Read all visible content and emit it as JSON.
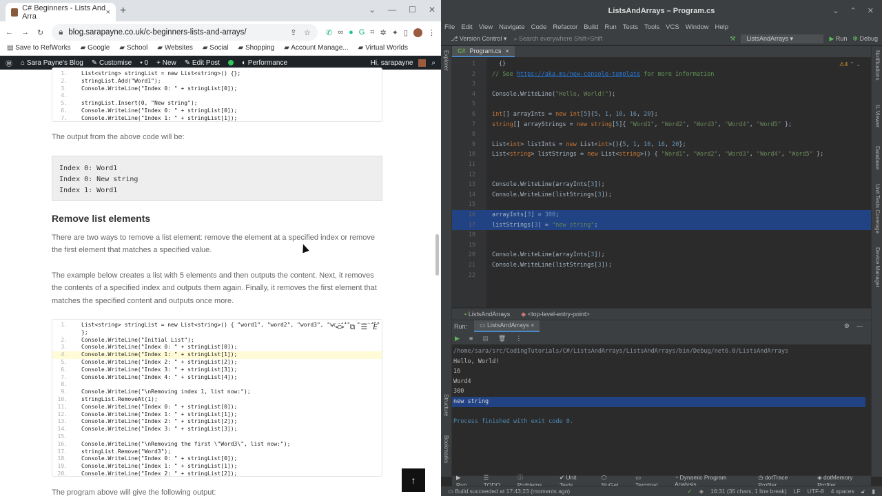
{
  "browser": {
    "tab_title": "C# Beginners - Lists And Arra",
    "tab_close": "×",
    "new_tab": "+",
    "url": "blog.sarapayne.co.uk/c-beginners-lists-and-arrays/",
    "bookmarks": [
      "Save to RefWorks",
      "Google",
      "School",
      "Websites",
      "Social",
      "Shopping",
      "Account Manage...",
      "Virtual Worlds"
    ],
    "wp_bar": {
      "site": "Sara Payne's Blog",
      "customise": "Customise",
      "comments": "0",
      "new": "New",
      "edit": "Edit Post",
      "performance": "Performance",
      "greeting": "Hi, sarapayne"
    }
  },
  "article": {
    "code1": [
      {
        "n": "1.",
        "t": "List<string> stringList = new List<string>() {};"
      },
      {
        "n": "2.",
        "t": "stringList.Add(\"Word1\");"
      },
      {
        "n": "3.",
        "t": "Console.WriteLine(\"Index 0: \" + stringList[0]);"
      },
      {
        "n": "4.",
        "t": ""
      },
      {
        "n": "5.",
        "t": "stringList.Insert(0, \"New string\");"
      },
      {
        "n": "6.",
        "t": "Console.WriteLine(\"Index 0: \" + stringList[0]);"
      },
      {
        "n": "7.",
        "t": "Console.WriteLine(\"Index 1: \" + stringList[1]);"
      }
    ],
    "output_intro": "The output from the above code will be:",
    "output1": [
      "Index 0: Word1",
      "Index 0: New string",
      "Index 1: Word1"
    ],
    "heading": "Remove list elements",
    "para1": "There are two ways to remove a list element: remove the element at a specified index or remove the first element that matches a specified value.",
    "para2": "The example below creates a list with 5 elements and then outputs the content. Next, it removes the contents of a specified index and outputs them again. Finally, it removes the first element that matches the specified content and outputs once more.",
    "code2": [
      {
        "n": "1.",
        "t": "List<string> stringList = new List<string>() { \"word1\", \"word2\", \"word3\", \"word4\", \"word5\""
      },
      {
        "n": "",
        "t": "};"
      },
      {
        "n": "2.",
        "t": "Console.WriteLine(\"Initial List\");"
      },
      {
        "n": "3.",
        "t": "Console.WriteLine(\"Index 0: \" + stringList[0]);"
      },
      {
        "n": "4.",
        "t": "Console.WriteLine(\"Index 1: \" + stringList[1]);"
      },
      {
        "n": "5.",
        "t": "Console.WriteLine(\"Index 2: \" + stringList[2]);"
      },
      {
        "n": "6.",
        "t": "Console.WriteLine(\"Index 3: \" + stringList[3]);"
      },
      {
        "n": "7.",
        "t": "Console.WriteLine(\"Index 4: \" + stringList[4]);"
      },
      {
        "n": "8.",
        "t": ""
      },
      {
        "n": "9.",
        "t": "Console.WriteLine(\"\\nRemoving index 1, list now:\");"
      },
      {
        "n": "10.",
        "t": "stringList.RemoveAt(1);"
      },
      {
        "n": "11.",
        "t": "Console.WriteLine(\"Index 0: \" + stringList[0]);"
      },
      {
        "n": "12.",
        "t": "Console.WriteLine(\"Index 1: \" + stringList[1]);"
      },
      {
        "n": "13.",
        "t": "Console.WriteLine(\"Index 2: \" + stringList[2]);"
      },
      {
        "n": "14.",
        "t": "Console.WriteLine(\"Index 3: \" + stringList[3]);"
      },
      {
        "n": "15.",
        "t": ""
      },
      {
        "n": "16.",
        "t": "Console.WriteLine(\"\\nRemoving the first \\\"Word3\\\", list now:\");"
      },
      {
        "n": "17.",
        "t": "stringList.Remove(\"Word3\");"
      },
      {
        "n": "18.",
        "t": "Console.WriteLine(\"Index 0: \" + stringList[0]);"
      },
      {
        "n": "19.",
        "t": "Console.WriteLine(\"Index 1: \" + stringList[1]);"
      },
      {
        "n": "20.",
        "t": "Console.WriteLine(\"Index 2: \" + stringList[2]);"
      }
    ],
    "code2_highlight_line": "4.",
    "tail": "The program above will give the following output:"
  },
  "ide": {
    "title": "ListsAndArrays – Program.cs",
    "menu": [
      "File",
      "Edit",
      "View",
      "Navigate",
      "Code",
      "Refactor",
      "Build",
      "Run",
      "Tests",
      "Tools",
      "VCS",
      "Window",
      "Help"
    ],
    "vcs": "Version Control",
    "search": "Search everywhere",
    "search_hint": "Shift+Shift",
    "config": "ListsAndArrays",
    "run": "Run",
    "debug": "Debug",
    "file_tab": "Program.cs",
    "warnings": "4",
    "left_tools": [
      "Explorer",
      "Structure",
      "Bookmarks"
    ],
    "right_tools": [
      "Notifications",
      "IL Viewer",
      "Database",
      "Unit Tests Coverage",
      "Device Manager"
    ],
    "breadcrumbs": [
      "ListsAndArrays",
      "<top-level-entry-point>"
    ],
    "run_label": "Run:",
    "run_tab": "ListsAndArrays",
    "output": [
      "/home/sara/src/CodingTutorials/C#/ListsAndArrays/ListsAndArrays/bin/Debug/net6.0/ListsAndArrays",
      "Hello, World!",
      "16",
      "Word4",
      "300",
      "new string",
      "",
      "Process finished with exit code 0."
    ],
    "bottom_tabs": [
      "Run",
      "TODO",
      "Problems",
      "Unit Tests",
      "NuGet",
      "Terminal",
      "Dynamic Program Analysis",
      "dotTrace Profiler",
      "dotMemory Profiler"
    ],
    "status": "Build succeeded at 17:43:23  (moments ago)",
    "status_right": [
      "16:31 (35 chars, 1 line break)",
      "LF",
      "UTF-8",
      "4 spaces"
    ]
  }
}
